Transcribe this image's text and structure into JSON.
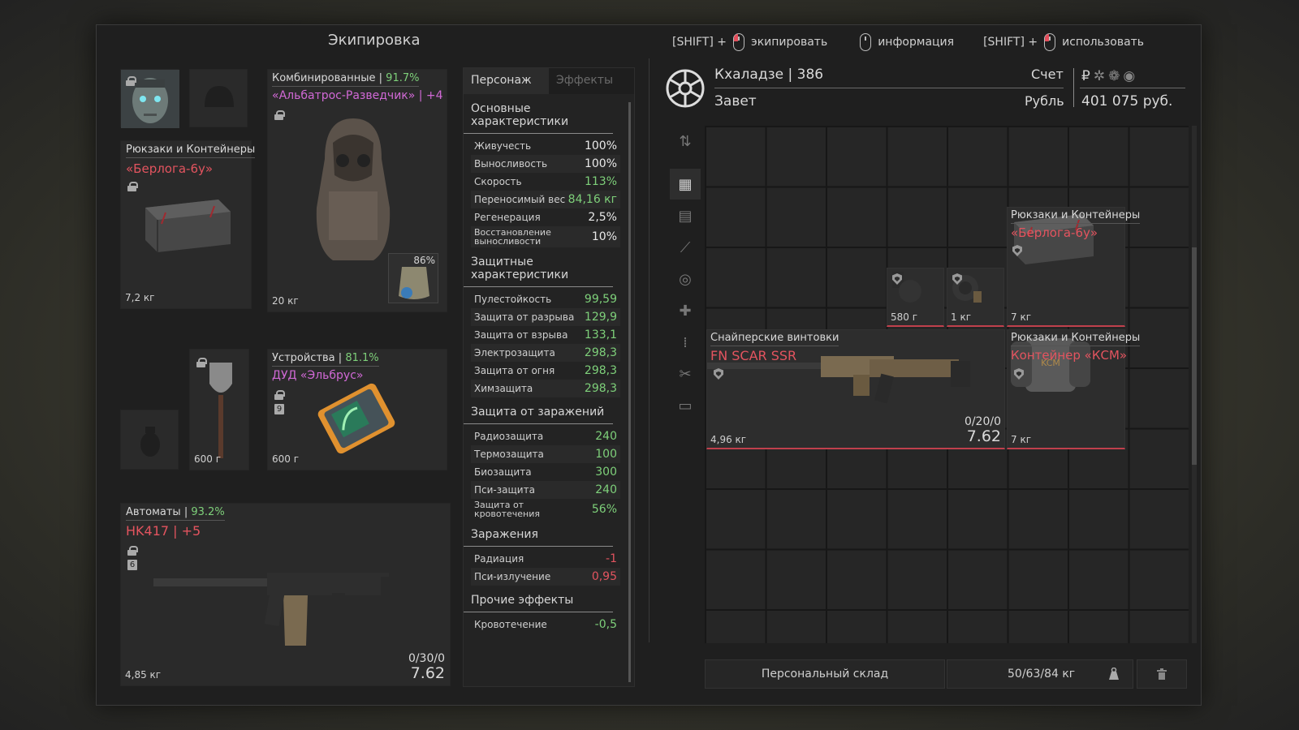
{
  "window": {
    "title": "Экипировка"
  },
  "hints": [
    {
      "prefix": "[SHIFT] +",
      "label": "экипировать"
    },
    {
      "prefix": "",
      "label": "информация"
    },
    {
      "prefix": "[SHIFT] +",
      "label": "использовать"
    }
  ],
  "equipment": {
    "backpack": {
      "category": "Рюкзаки и Контейнеры",
      "name": "«Берлога-6у»",
      "weight": "7,2 кг"
    },
    "armor": {
      "category": "Комбинированные",
      "sep": "|",
      "percent": "91.7%",
      "name": "«Альбатрос-Разведчик» | +4",
      "weight": "20 кг",
      "plate_percent": "86%"
    },
    "devices": {
      "category": "Устройства",
      "sep": "|",
      "percent": "81.1%",
      "name": "ДУД «Эльбрус»",
      "weight": "600 г",
      "badge": "9"
    },
    "melee": {
      "weight": "600 г"
    },
    "rifle": {
      "category": "Автоматы",
      "sep": "|",
      "percent": "93.2%",
      "name": "HK417 | +5",
      "weight": "4,85 кг",
      "ammo_count": "0/30/0",
      "caliber": "7.62",
      "badge": "6"
    }
  },
  "stats": {
    "tabs": [
      "Персонаж",
      "Эффекты"
    ],
    "sections": [
      {
        "title": "Основные характеристики",
        "rows": [
          {
            "k": "Живучесть",
            "v": "100%",
            "c": ""
          },
          {
            "k": "Выносливость",
            "v": "100%",
            "c": ""
          },
          {
            "k": "Скорость",
            "v": "113%",
            "c": "green"
          },
          {
            "k": "Переносимый вес",
            "v": "84,16 кг",
            "c": "green"
          },
          {
            "k": "Регенерация",
            "v": "2,5%",
            "c": ""
          },
          {
            "k": "Восстановление выносливости",
            "v": "10%",
            "c": "",
            "two": true
          }
        ]
      },
      {
        "title": "Защитные характеристики",
        "rows": [
          {
            "k": "Пулестойкость",
            "v": "99,59",
            "c": "green"
          },
          {
            "k": "Защита от разрыва",
            "v": "129,9",
            "c": "green"
          },
          {
            "k": "Защита от взрыва",
            "v": "133,1",
            "c": "green"
          },
          {
            "k": "Электрозащита",
            "v": "298,3",
            "c": "green"
          },
          {
            "k": "Защита от огня",
            "v": "298,3",
            "c": "green"
          },
          {
            "k": "Химзащита",
            "v": "298,3",
            "c": "green"
          }
        ]
      },
      {
        "title": "Защита от заражений",
        "rows": [
          {
            "k": "Радиозащита",
            "v": "240",
            "c": "green"
          },
          {
            "k": "Термозащита",
            "v": "100",
            "c": "green"
          },
          {
            "k": "Биозащита",
            "v": "300",
            "c": "green"
          },
          {
            "k": "Пси-защита",
            "v": "240",
            "c": "green"
          },
          {
            "k": "Защита от кровотечения",
            "v": "56%",
            "c": "green",
            "two": true
          }
        ]
      },
      {
        "title": "Заражения",
        "rows": [
          {
            "k": "Радиация",
            "v": "-1",
            "c": "red"
          },
          {
            "k": "Пси-излучение",
            "v": "0,95",
            "c": "red"
          }
        ]
      },
      {
        "title": "Прочие эффекты",
        "rows": [
          {
            "k": "Кровотечение",
            "v": "-0,5",
            "c": "green"
          }
        ]
      }
    ]
  },
  "player": {
    "name": "Кхаладзе",
    "sep": "|",
    "level": "386",
    "faction": "Завет",
    "account_label": "Счет",
    "currency_label": "Рубль",
    "money": "401 075 руб.",
    "currency_symbol": "₽"
  },
  "inventory": {
    "items": [
      {
        "weight": "580 г"
      },
      {
        "weight": "1 кг"
      },
      {
        "category": "Рюкзаки и Контейнеры",
        "name": "«Берлога-6у»",
        "weight": "7 кг"
      },
      {
        "category": "Снайперские винтовки",
        "name": "FN SCAR SSR",
        "weight": "4,96 кг",
        "ammo_count": "0/20/0",
        "caliber": "7.62"
      },
      {
        "category": "Рюкзаки и Контейнеры",
        "name": "Контейнер «КСМ»",
        "weight": "7 кг"
      }
    ],
    "storage_label": "Персональный склад",
    "capacity": "50/63/84 кг"
  },
  "colors": {
    "accent_red": "#e3545f",
    "green": "#7ed07a",
    "pink": "#d169d6"
  }
}
